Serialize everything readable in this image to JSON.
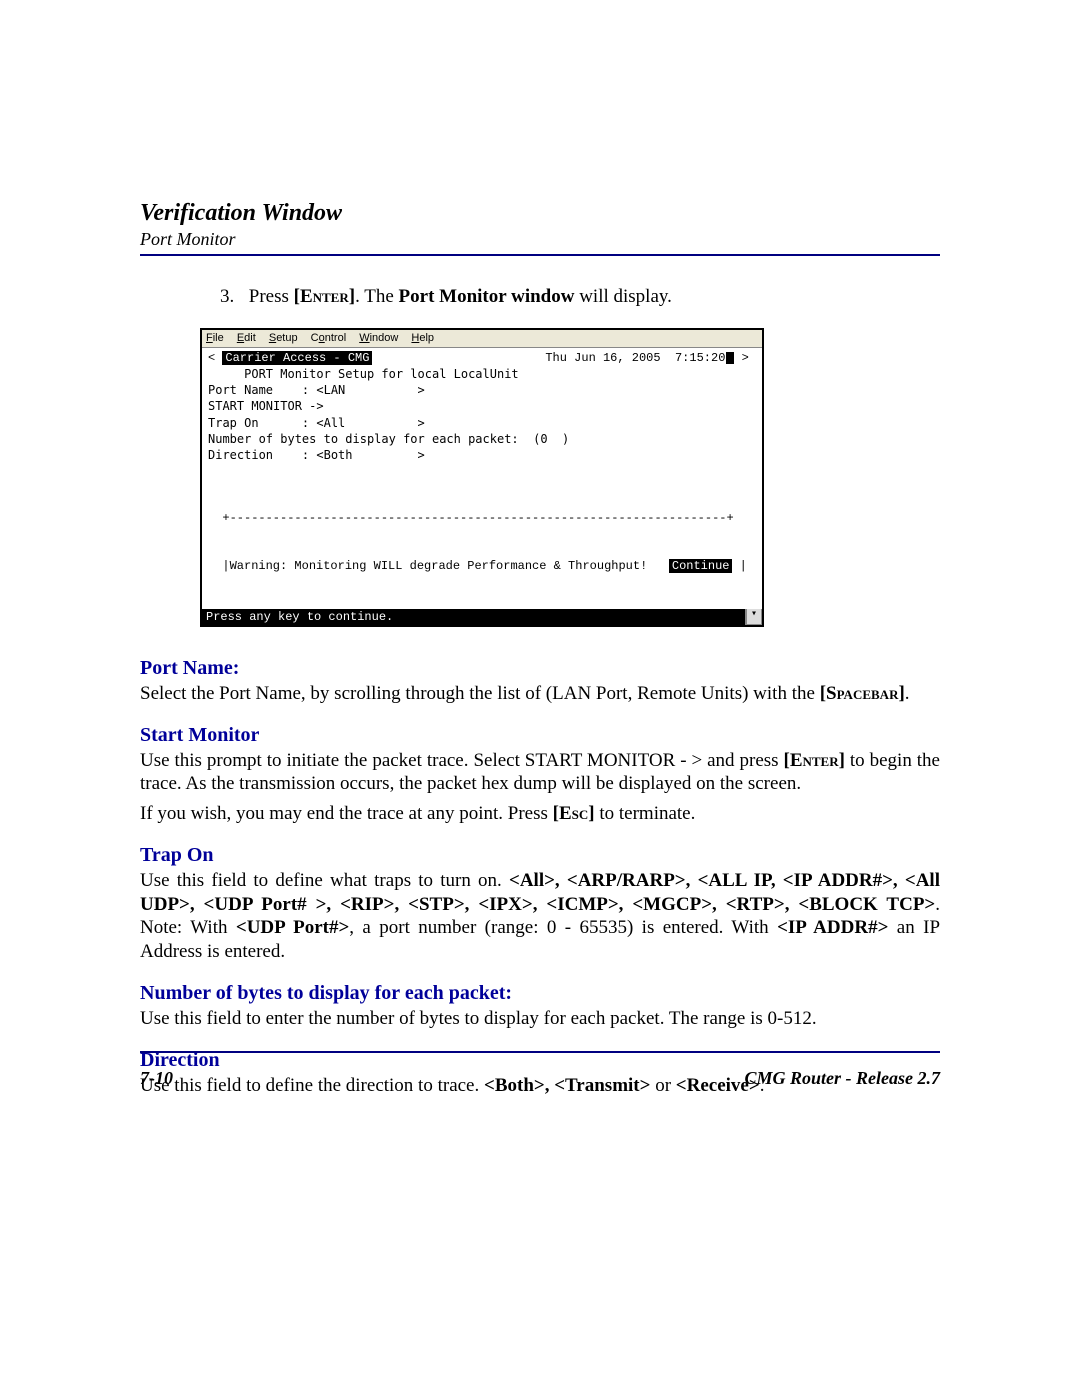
{
  "header": {
    "title": "Verification Window",
    "subtitle": "Port Monitor"
  },
  "step": {
    "number": "3.",
    "text_pre": "Press ",
    "key": "[Enter]",
    "text_mid": ". The ",
    "bold": "Port Monitor window",
    "text_post": " will display."
  },
  "terminal": {
    "menubar": [
      "File",
      "Edit",
      "Setup",
      "Control",
      "Window",
      "Help"
    ],
    "lt": "<",
    "title": "Carrier Access - CMG",
    "timestamp_pre": "Thu Jun 16, 2005  7:15:20",
    "arrow_gt": "> ",
    "body_lines": [
      "",
      "     PORT Monitor Setup for local LocalUnit",
      "",
      "Port Name    : <LAN          >",
      "",
      "START MONITOR ->",
      "",
      "Trap On      : <All          >",
      "",
      "Number of bytes to display for each packet:  (0  )",
      "",
      "Direction    : <Both         >",
      "",
      ""
    ],
    "warn_border": "  +---------------------------------------------------------------------+",
    "warn_line_pre": "  |Warning: Monitoring WILL degrade Performance & Throughput!   ",
    "warn_continue": "Continue",
    "warn_line_post": " |",
    "footer": "Press any key to continue."
  },
  "sections": {
    "port_name": {
      "heading": "Port Name:",
      "p1_a": "Select the Port Name, by scrolling through the list of (LAN Port, Remote Units) with the ",
      "p1_key": "[Spacebar]",
      "p1_b": "."
    },
    "start_monitor": {
      "heading": "Start Monitor",
      "p1_a": "Use this prompt to initiate the packet trace. Select START MONITOR - > and press ",
      "p1_key": "[Enter]",
      "p1_b": " to begin the trace. As the transmission occurs, the packet hex dump will be displayed on the screen.",
      "p2_a": "If you wish, you may end the trace at any point. Press ",
      "p2_key": "[Esc]",
      "p2_b": " to terminate."
    },
    "trap_on": {
      "heading": "Trap On",
      "p1_a": "Use this field to define what traps to turn on. ",
      "opts": "<All>, <ARP/RARP>, <ALL IP, <IP ADDR#>, <All UDP>, <UDP Port# >, <RIP>, <STP>, <IPX>, <ICMP>, <MGCP>, <RTP>, <BLOCK TCP>",
      "p1_b": ". Note: With ",
      "udp": "<UDP Port#>",
      "p1_c": ", a port number (range: 0 - 65535) is entered. With ",
      "ip": "<IP ADDR#>",
      "p1_d": " an IP Address is entered."
    },
    "bytes": {
      "heading": "Number of bytes to display for each packet:",
      "p1": "Use this field to enter the number of bytes to display for each packet. The range is 0-512."
    },
    "direction": {
      "heading": "Direction",
      "p1_a": "Use this field to define the direction to trace. ",
      "opts": "<Both>, <Transmit>",
      "p1_b": " or ",
      "opt3": "<Receive>",
      "p1_c": "."
    }
  },
  "footer": {
    "page": "7-10",
    "doc": "CMG Router - Release 2.7"
  }
}
